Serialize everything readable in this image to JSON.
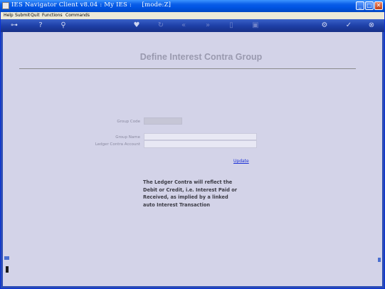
{
  "window": {
    "title": "IES Navigator Client v8.04 : My IES :     [mode:Z]",
    "controls": {
      "minimize": "_",
      "maximize": "□",
      "close": "✕"
    }
  },
  "menubar": {
    "items": [
      "Help",
      "Submit",
      "Quit",
      "Functions",
      "Commands"
    ]
  },
  "toolbar": {
    "icons": [
      "key-icon",
      "help-icon",
      "search-icon",
      "heart-icon",
      "refresh-icon",
      "back-back-icon",
      "forward-forward-icon",
      "doc-icon",
      "stop-icon",
      "settings-icon",
      "check-icon",
      "close-icon"
    ],
    "glyphs": {
      "key": "⊶",
      "help": "?",
      "search": "⚲",
      "heart": "♥",
      "refresh": "↻",
      "back": "«",
      "forward": "»",
      "doc": "▯",
      "stop": "▣",
      "settings": "⚙",
      "check": "✓",
      "close": "⊗"
    }
  },
  "form": {
    "title": "Define Interest Contra Group",
    "group_code_label": "Group Code",
    "group_code_value": "",
    "group_name_label": "Group Name",
    "group_name_value": "",
    "ledger_contra_label": "Ledger Contra Account",
    "ledger_contra_value": "",
    "update_label": "Update",
    "note_lines": [
      "The Ledger Contra will reflect the",
      "Debit or Credit, i.e. Interest Paid or",
      "Received, as implied by a linked",
      "auto Interest Transaction"
    ]
  }
}
